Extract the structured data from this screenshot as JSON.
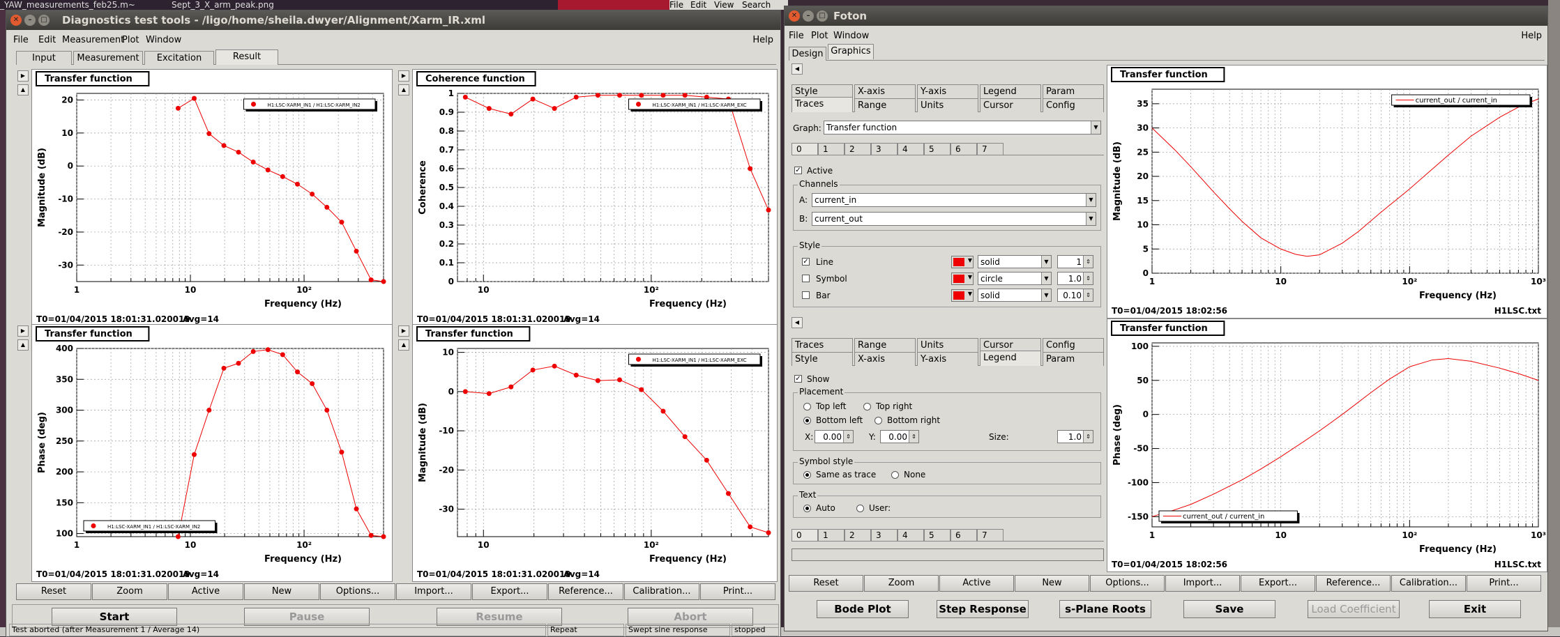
{
  "background": {
    "topbar_text": "_YAW_measurements_feb25.m~",
    "topbar_text2": "Sept_3_X_arm_peak.png",
    "topbar_menu": [
      "File",
      "Edit",
      "View",
      "Search"
    ],
    "colors": {
      "desktop": "#3a2a35"
    }
  },
  "diag": {
    "title": "Diagnostics test tools - /ligo/home/sheila.dwyer/Alignment/Xarm_IR.xml",
    "menu": [
      "File",
      "Edit",
      "Measurement",
      "Plot",
      "Window"
    ],
    "help": "Help",
    "tabs": [
      "Input",
      "Measurement",
      "Excitation",
      "Result"
    ],
    "plot_buttons": [
      "Reset",
      "Zoom",
      "Active",
      "New",
      "Options...",
      "Import...",
      "Export...",
      "Reference...",
      "Calibration...",
      "Print..."
    ],
    "run_buttons": [
      "Start",
      "Pause",
      "Resume",
      "Abort"
    ],
    "status": [
      "Test aborted (after Measurement 1 / Average 14)",
      "Repeat",
      "Swept sine response",
      "stopped"
    ]
  },
  "foton": {
    "title": "Foton",
    "menu": [
      "File",
      "Plot",
      "Window"
    ],
    "help": "Help",
    "tabs": [
      "Design",
      "Graphics"
    ],
    "top_tabs_row1": [
      "Style",
      "X-axis",
      "Y-axis",
      "Legend",
      "Param"
    ],
    "top_tabs_row2": [
      "Traces",
      "Range",
      "Units",
      "Cursor",
      "Config"
    ],
    "graph_label": "Graph:",
    "graph_value": "Transfer function",
    "trace_numbers": [
      "0",
      "1",
      "2",
      "3",
      "4",
      "5",
      "6",
      "7"
    ],
    "active_label": "Active",
    "channels_label": "Channels",
    "channel_a_label": "A:",
    "channel_a": "current_in",
    "channel_b_label": "B:",
    "channel_b": "current_out",
    "style_label": "Style",
    "style_rows": [
      {
        "label": "Line",
        "checked": true,
        "type": "solid",
        "size": "1"
      },
      {
        "label": "Symbol",
        "checked": false,
        "type": "circle",
        "size": "1.0"
      },
      {
        "label": "Bar",
        "checked": false,
        "type": "solid",
        "size": "0.10"
      }
    ],
    "bottom_tabs_row1": [
      "Traces",
      "Range",
      "Units",
      "Cursor",
      "Config"
    ],
    "bottom_tabs_row2": [
      "Style",
      "X-axis",
      "Y-axis",
      "Legend",
      "Param"
    ],
    "show_label": "Show",
    "placement_label": "Placement",
    "placement": [
      "Top left",
      "Top right",
      "Bottom left",
      "Bottom right"
    ],
    "x_label": "X:",
    "x_value": "0.00",
    "y_label": "Y:",
    "y_value": "0.00",
    "size_label": "Size:",
    "size_value": "1.0",
    "symbol_style_label": "Symbol style",
    "symbol_style": [
      "Same as trace",
      "None"
    ],
    "text_label": "Text",
    "text_options": [
      "Auto",
      "User:"
    ],
    "plot_buttons": [
      "Reset",
      "Zoom",
      "Active",
      "New",
      "Options...",
      "Import...",
      "Export...",
      "Reference...",
      "Calibration...",
      "Print..."
    ],
    "bottom_buttons": [
      "Bode Plot",
      "Step Response",
      "s-Plane Roots",
      "Save",
      "Load Coefficient",
      "Exit"
    ]
  },
  "chart_data": [
    {
      "id": "diag-tf-mag",
      "type": "scatter",
      "title": "Transfer function",
      "xlabel": "Frequency (Hz)",
      "ylabel": "Magnitude (dB)",
      "xscale": "log",
      "xlim": [
        1,
        500
      ],
      "ylim": [
        -35,
        22
      ],
      "yticks": [
        -30,
        -20,
        -10,
        0,
        10,
        20
      ],
      "legend": "H1:LSC-XARM_IN1 / H1:LSC-XARM_IN2",
      "legend_position": "top-right",
      "x": [
        7.8,
        10.8,
        14.6,
        19.7,
        26.5,
        35.7,
        48.1,
        64.8,
        87.4,
        117.8,
        158.8,
        214.0,
        288.4,
        388.7,
        500
      ],
      "y": [
        17.5,
        20.5,
        9.8,
        6.2,
        4.2,
        1.2,
        -1.2,
        -3.2,
        -5.5,
        -8.5,
        -12.5,
        -17.0,
        -25.8,
        -34.5,
        -37
      ],
      "footer": "T0=01/04/2015 18:01:31.020019",
      "avg": "Avg=14"
    },
    {
      "id": "diag-coh",
      "type": "scatter",
      "title": "Coherence function",
      "xlabel": "Frequency (Hz)",
      "ylabel": "Coherence",
      "xscale": "log",
      "xlim": [
        7,
        500
      ],
      "ylim": [
        0,
        1
      ],
      "yticks": [
        0,
        0.1,
        0.2,
        0.3,
        0.4,
        0.5,
        0.6,
        0.7,
        0.8,
        0.9,
        1
      ],
      "legend": "H1:LSC-XARM_IN1 / H1:LSC-XARM_EXC",
      "legend_position": "top-right",
      "x": [
        7.8,
        10.8,
        14.6,
        19.7,
        26.5,
        35.7,
        48.1,
        64.8,
        87.4,
        117.8,
        158.8,
        214.0,
        288.4,
        388.7,
        500
      ],
      "y": [
        0.98,
        0.92,
        0.89,
        0.97,
        0.92,
        0.98,
        0.99,
        0.99,
        0.99,
        0.99,
        0.99,
        0.98,
        0.97,
        0.6,
        0.38
      ],
      "footer": "T0=01/04/2015 18:01:31.020019",
      "avg": "Avg=14"
    },
    {
      "id": "diag-tf-phase",
      "type": "scatter",
      "title": "Transfer function",
      "xlabel": "Frequency (Hz)",
      "ylabel": "Phase (deg)",
      "xscale": "log",
      "xlim": [
        1,
        500
      ],
      "ylim": [
        95,
        400
      ],
      "yticks": [
        100,
        150,
        200,
        250,
        300,
        350,
        400
      ],
      "legend": "H1:LSC-XARM_IN1 / H1:LSC-XARM_IN2",
      "legend_position": "bottom-left",
      "x": [
        7.8,
        10.8,
        14.6,
        19.7,
        26.5,
        35.7,
        48.1,
        64.8,
        87.4,
        117.8,
        158.8,
        214.0,
        288.4,
        388.7,
        500
      ],
      "y": [
        92,
        228,
        300,
        368,
        376,
        395,
        398,
        390,
        362,
        343,
        300,
        232,
        140,
        97,
        90
      ],
      "footer": "T0=01/04/2015 18:01:31.020019",
      "avg": "Avg=14"
    },
    {
      "id": "diag-tf-mag2",
      "type": "scatter",
      "title": "Transfer function",
      "xlabel": "Frequency (Hz)",
      "ylabel": "Magnitude (dB)",
      "xscale": "log",
      "xlim": [
        7,
        500
      ],
      "ylim": [
        -37,
        11
      ],
      "yticks": [
        -30,
        -20,
        -10,
        0,
        10
      ],
      "legend": "H1:LSC-XARM_IN1 / H1:LSC-XARM_EXC",
      "legend_position": "top-right",
      "x": [
        7.8,
        10.8,
        14.6,
        19.7,
        26.5,
        35.7,
        48.1,
        64.8,
        87.4,
        117.8,
        158.8,
        214.0,
        288.4,
        388.7,
        500
      ],
      "y": [
        0,
        -0.5,
        1.2,
        5.5,
        6.5,
        4.2,
        2.8,
        3.0,
        0.5,
        -5,
        -11.5,
        -17.5,
        -26,
        -34.5,
        -36
      ],
      "footer": "T0=01/04/2015 18:01:31.020019",
      "avg": "Avg=14"
    },
    {
      "id": "foton-mag",
      "type": "line",
      "title": "Transfer function",
      "xlabel": "Frequency (Hz)",
      "ylabel": "Magnitude (dB)",
      "xscale": "log",
      "xlim": [
        1,
        1000
      ],
      "ylim": [
        0,
        38
      ],
      "yticks": [
        0,
        5,
        10,
        15,
        20,
        25,
        30,
        35
      ],
      "legend": "current_out / current_in",
      "legend_position": "top-right",
      "x": [
        1,
        1.5,
        2,
        3,
        4,
        5,
        7,
        10,
        13,
        16,
        20,
        30,
        40,
        60,
        100,
        150,
        200,
        300,
        500,
        700,
        1000
      ],
      "y": [
        30,
        25.5,
        22,
        16.8,
        13.3,
        10.7,
        7.3,
        5,
        3.9,
        3.5,
        3.8,
        6.2,
        8.6,
        12.6,
        17.4,
        21.5,
        24.4,
        28.3,
        32.2,
        34.3,
        36
      ],
      "footer": "T0=01/04/2015 18:02:56",
      "right_footer": "H1LSC.txt"
    },
    {
      "id": "foton-phase",
      "type": "line",
      "title": "Transfer function",
      "xlabel": "Frequency (Hz)",
      "ylabel": "Phase (deg)",
      "xscale": "log",
      "xlim": [
        1,
        1000
      ],
      "ylim": [
        -165,
        105
      ],
      "yticks": [
        -150,
        -100,
        -50,
        0,
        50,
        100
      ],
      "legend": "current_out / current_in",
      "legend_position": "bottom-left",
      "x": [
        1,
        1.5,
        2,
        3,
        5,
        7,
        10,
        15,
        20,
        30,
        50,
        70,
        100,
        150,
        200,
        300,
        500,
        700,
        1000
      ],
      "y": [
        -150,
        -140,
        -132,
        -117,
        -96,
        -80,
        -62,
        -40,
        -24,
        0,
        32,
        52,
        70,
        80,
        82,
        78,
        68,
        60,
        50
      ],
      "footer": "T0=01/04/2015 18:02:56",
      "right_footer": "H1LSC.txt"
    }
  ]
}
